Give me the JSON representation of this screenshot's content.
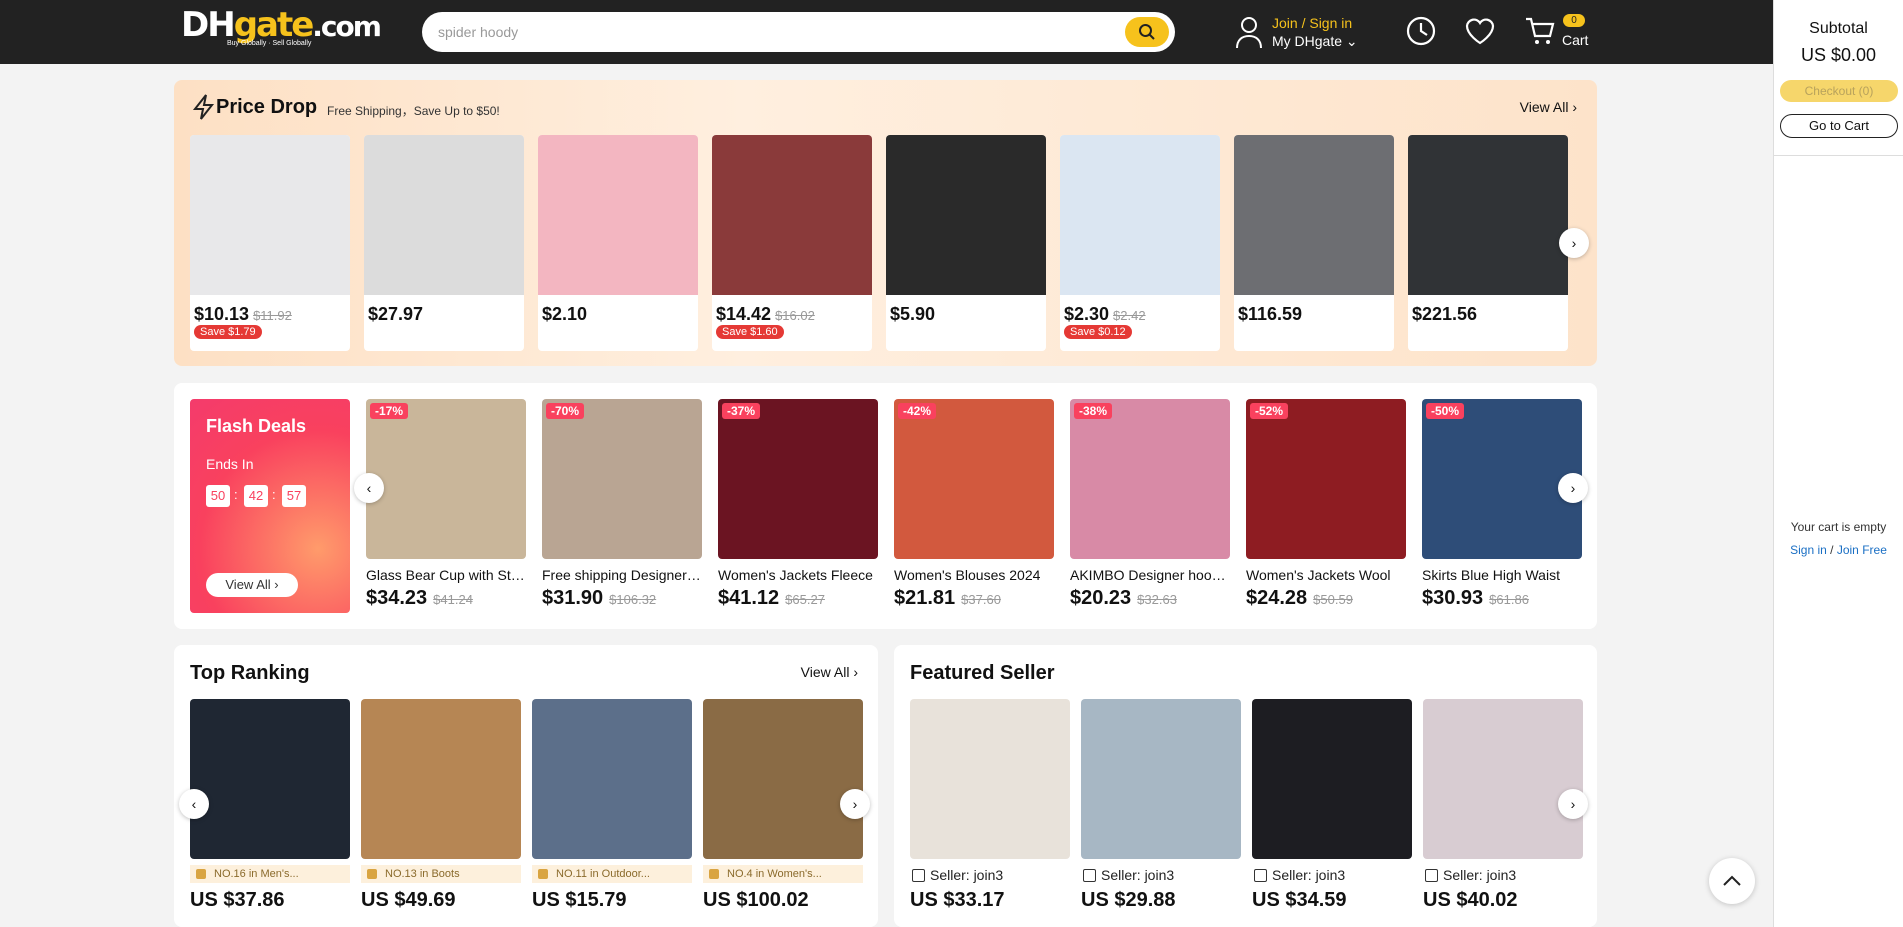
{
  "header": {
    "logo_main": "DH",
    "logo_accent": "gate",
    "logo_suffix": ".com",
    "logo_tagline": "Buy Globally · Sell Globally",
    "search_placeholder": "spider hoody",
    "join": "Join / Sign in",
    "my": "My DHgate",
    "cart_label": "Cart",
    "cart_count": "0",
    "icons": [
      "search-icon",
      "user-icon",
      "history-icon",
      "heart-icon",
      "cart-icon"
    ]
  },
  "sidebar": {
    "subtotal": "Subtotal",
    "amount": "US $0.00",
    "checkout": "Checkout (0)",
    "go_cart": "Go to Cart",
    "empty": "Your cart is empty",
    "sign_in": "Sign in",
    "join": "Join Free",
    "sep": "/"
  },
  "price_drop": {
    "title": "Price Drop",
    "subtitle": "Free Shipping，Save Up to $50!",
    "view_all": "View All",
    "items": [
      {
        "price": "$10.13",
        "old": "$11.92",
        "save": "Save $1.79",
        "color": "#e8e8ea"
      },
      {
        "price": "$27.97",
        "old": "",
        "save": "",
        "color": "#dcdcdc"
      },
      {
        "price": "$2.10",
        "old": "",
        "save": "",
        "color": "#f3b6c1"
      },
      {
        "price": "$14.42",
        "old": "$16.02",
        "save": "Save $1.60",
        "color": "#8a3a3a"
      },
      {
        "price": "$5.90",
        "old": "",
        "save": "",
        "color": "#2a2a2a"
      },
      {
        "price": "$2.30",
        "old": "$2.42",
        "save": "Save $0.12",
        "color": "#dbe6f2"
      },
      {
        "price": "$116.59",
        "old": "",
        "save": "",
        "color": "#6d6e72"
      },
      {
        "price": "$221.56",
        "old": "",
        "save": "",
        "color": "#303336"
      }
    ]
  },
  "flash": {
    "title": "Flash Deals",
    "ends": "Ends In",
    "h": "50",
    "m": "42",
    "s": "57",
    "colon": ":",
    "view_all": "View All",
    "items": [
      {
        "badge": "-17%",
        "name": "Glass Bear Cup with Straw",
        "price": "$34.23",
        "old": "$41.24",
        "color": "#c9b69a"
      },
      {
        "badge": "-70%",
        "name": "Free shipping Designer Boots",
        "price": "$31.90",
        "old": "$106.32",
        "color": "#b9a593"
      },
      {
        "badge": "-37%",
        "name": "Women's Jackets Fleece",
        "price": "$41.12",
        "old": "$65.27",
        "color": "#6b1422"
      },
      {
        "badge": "-42%",
        "name": "Women's Blouses 2024",
        "price": "$21.81",
        "old": "$37.60",
        "color": "#d2593e"
      },
      {
        "badge": "-38%",
        "name": "AKIMBO Designer hoodie",
        "price": "$20.23",
        "old": "$32.63",
        "color": "#d88aa6"
      },
      {
        "badge": "-52%",
        "name": "Women's Jackets Wool",
        "price": "$24.28",
        "old": "$50.59",
        "color": "#8e1c22"
      },
      {
        "badge": "-50%",
        "name": "Skirts Blue High Waist",
        "price": "$30.93",
        "old": "$61.86",
        "color": "#2e4d78"
      }
    ]
  },
  "top_ranking": {
    "title": "Top Ranking",
    "view_all": "View All",
    "items": [
      {
        "rank": "NO.16 in Men's...",
        "price": "US $37.86",
        "color": "#1f2733"
      },
      {
        "rank": "NO.13 in Boots",
        "price": "US $49.69",
        "color": "#b68654"
      },
      {
        "rank": "NO.11 in Outdoor...",
        "price": "US $15.79",
        "color": "#5c6f8a"
      },
      {
        "rank": "NO.4 in Women's...",
        "price": "US $100.02",
        "color": "#8a6b45"
      }
    ]
  },
  "featured": {
    "title": "Featured Seller",
    "items": [
      {
        "seller": "Seller: join3",
        "price": "US $33.17",
        "color": "#e8e2da"
      },
      {
        "seller": "Seller: join3",
        "price": "US $29.88",
        "color": "#a7b7c4"
      },
      {
        "seller": "Seller: join3",
        "price": "US $34.59",
        "color": "#1d1d22"
      },
      {
        "seller": "Seller: join3",
        "price": "US $40.02",
        "color": "#d8ccd2"
      }
    ]
  }
}
